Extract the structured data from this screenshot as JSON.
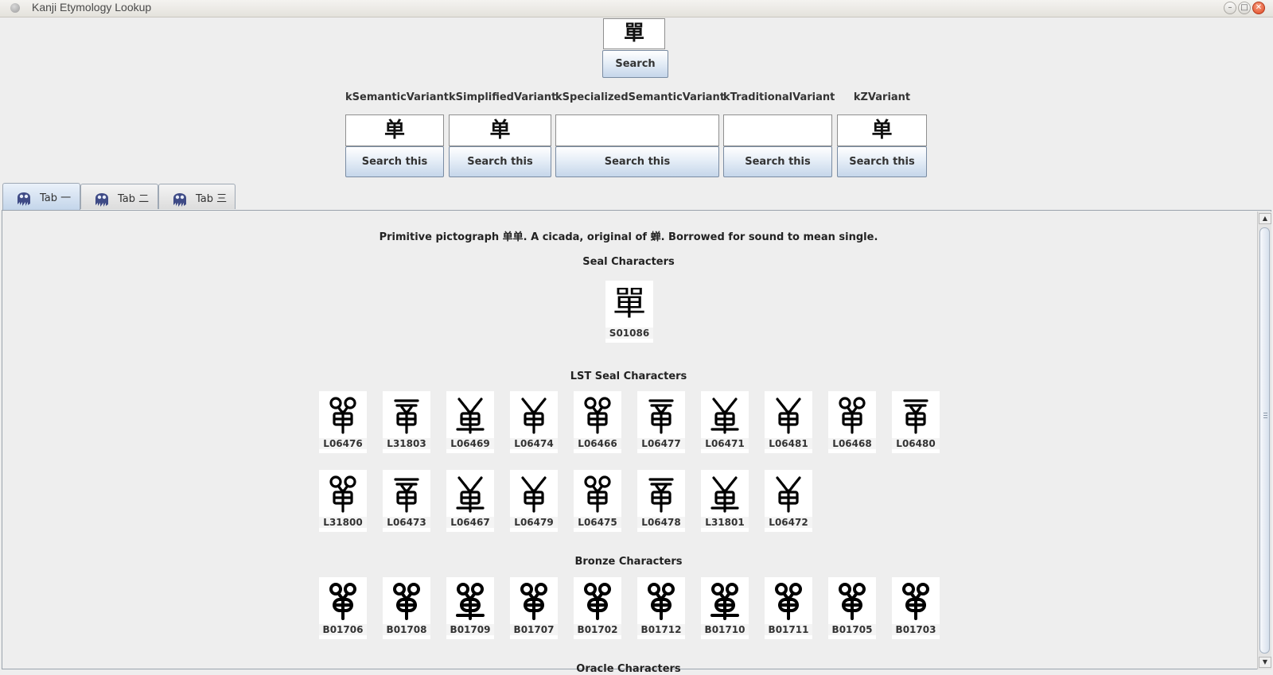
{
  "window": {
    "title": "Kanji Etymology Lookup"
  },
  "search": {
    "query": "單",
    "button_label": "Search"
  },
  "variants": [
    {
      "label": "kSemanticVariant",
      "value": "单",
      "button_label": "Search this"
    },
    {
      "label": "kSimplifiedVariant",
      "value": "单",
      "button_label": "Search this"
    },
    {
      "label": "kSpecializedSemanticVariant",
      "value": "",
      "button_label": "Search this"
    },
    {
      "label": "kTraditionalVariant",
      "value": "",
      "button_label": "Search this"
    },
    {
      "label": "kZVariant",
      "value": "单",
      "button_label": "Search this"
    }
  ],
  "tabs": [
    {
      "label": "Tab 一",
      "icon": "ghost-icon",
      "active": true
    },
    {
      "label": "Tab 二",
      "icon": "ghost-icon",
      "active": false
    },
    {
      "label": "Tab 三",
      "icon": "ghost-icon",
      "active": false
    }
  ],
  "content": {
    "description": "Primitive pictograph 单单. A cicada, original of 蝉. Borrowed for sound to mean single.",
    "seal": {
      "title": "Seal Characters",
      "items": [
        {
          "code": "S01086",
          "glyph": "單"
        }
      ]
    },
    "lst_seal": {
      "title": "LST Seal Characters",
      "row1": [
        "L06476",
        "L31803",
        "L06469",
        "L06474",
        "L06466",
        "L06477",
        "L06471",
        "L06481",
        "L06468",
        "L06480"
      ],
      "row2": [
        "L31800",
        "L06473",
        "L06467",
        "L06479",
        "L06475",
        "L06478",
        "L31801",
        "L06472"
      ]
    },
    "bronze": {
      "title": "Bronze Characters",
      "row1": [
        "B01706",
        "B01708",
        "B01709",
        "B01707",
        "B01702",
        "B01712",
        "B01710",
        "B01711",
        "B01705",
        "B01703"
      ]
    },
    "oracle": {
      "title": "Oracle Characters"
    }
  },
  "colors": {
    "window_bg": "#eeeeee",
    "button_top": "#ffffff",
    "button_bottom": "#c5d6ea",
    "close_button": "#e0461f"
  }
}
